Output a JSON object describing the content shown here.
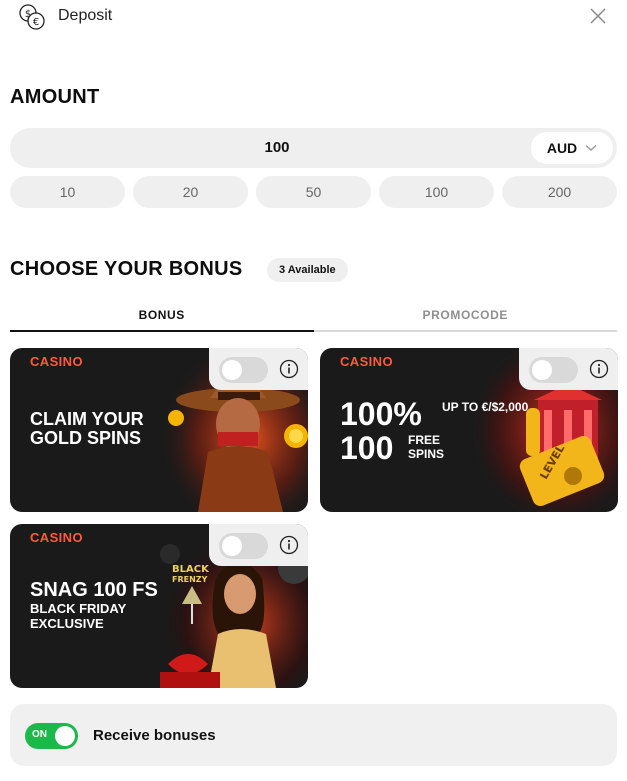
{
  "header": {
    "title": "Deposit",
    "icon": "coins-icon",
    "close_icon": "close-icon"
  },
  "amount": {
    "title": "AMOUNT",
    "value": "100",
    "currency": "AUD",
    "presets": [
      "10",
      "20",
      "50",
      "100",
      "200"
    ]
  },
  "bonus": {
    "title": "CHOOSE YOUR BONUS",
    "available": "3 Available",
    "tabs": [
      {
        "label": "BONUS",
        "active": true
      },
      {
        "label": "PROMOCODE",
        "active": false
      }
    ],
    "cards": [
      {
        "logo": "CASINO",
        "headline": "CLAIM YOUR GOLD SPINS",
        "enabled": false
      },
      {
        "logo": "CASINO",
        "big1": "100%",
        "small1": "UP TO €/$2,000",
        "big2": "100",
        "small2": "FREE SPINS",
        "enabled": false
      },
      {
        "logo": "CASINO",
        "headline": "SNAG 100 FS",
        "sub": "BLACK FRIDAY EXCLUSIVE",
        "enabled": false
      }
    ]
  },
  "receive": {
    "toggle_label": "ON",
    "label": "Receive bonuses",
    "enabled": true
  },
  "colors": {
    "brand": "#ff5a3c",
    "on": "#1bb84a",
    "card_bg": "#1a1a1a"
  }
}
